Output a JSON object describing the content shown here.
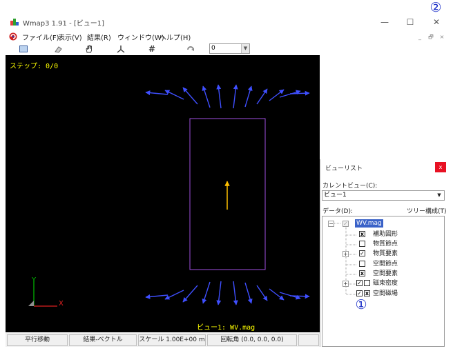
{
  "window": {
    "title": "Wmap3 1.91 - [ビュー1]",
    "min_symbol": "—",
    "max_symbol": "☐",
    "close_symbol": "✕"
  },
  "annotations": {
    "callout_1": "①",
    "callout_2": "②"
  },
  "menu": {
    "items": [
      {
        "label": "ファイル(F)"
      },
      {
        "label": "表示(V)"
      },
      {
        "label": "結果(R)"
      },
      {
        "label": "ウィンドウ(W)"
      },
      {
        "label": "ヘルプ(H)"
      }
    ],
    "mdi_min": "_",
    "mdi_restore": "🗗",
    "mdi_close": "×"
  },
  "toolbar": {
    "zoom_value": "0",
    "icons": [
      "frame-icon",
      "eraser-icon",
      "hand-icon",
      "axes-icon",
      "grid-icon",
      "rotate-icon"
    ],
    "grid_glyph": "#"
  },
  "viewport": {
    "step_label": "ステップ: 0/0",
    "caption": "ビュー1: WV.mag",
    "axis_y": "Y",
    "axis_x": "X",
    "colors": {
      "background": "#000000",
      "field_arrow": "#3f4fff",
      "body_outline": "#a050e0",
      "center_arrow": "#ffc000"
    }
  },
  "statusbar": {
    "cells": [
      "平行移動",
      "結果-ベクトル",
      "スケール 1.00E+00 m",
      "回転角 (0.0, 0.0, 0.0)"
    ]
  },
  "viewlist": {
    "title": "ビューリスト",
    "close_symbol": "x",
    "current_view_label": "カレントビュー(C):",
    "current_view_value": "ビュー1",
    "data_label": "データ(D):",
    "tree_config_label": "ツリー構成(T)",
    "tree": {
      "root": "WV.mag",
      "items": [
        {
          "label": "補助図形",
          "checks": [
            "x"
          ]
        },
        {
          "label": "物質節点",
          "checks": [
            ""
          ]
        },
        {
          "label": "物質要素",
          "checks": [
            "✓"
          ]
        },
        {
          "label": "空間節点",
          "checks": [
            ""
          ]
        },
        {
          "label": "空間要素",
          "checks": [
            "x"
          ]
        },
        {
          "label": "磁束密度",
          "checks": [
            "✓",
            ""
          ]
        },
        {
          "label": "空間磁場",
          "checks": [
            "✓",
            "x"
          ]
        }
      ]
    }
  }
}
